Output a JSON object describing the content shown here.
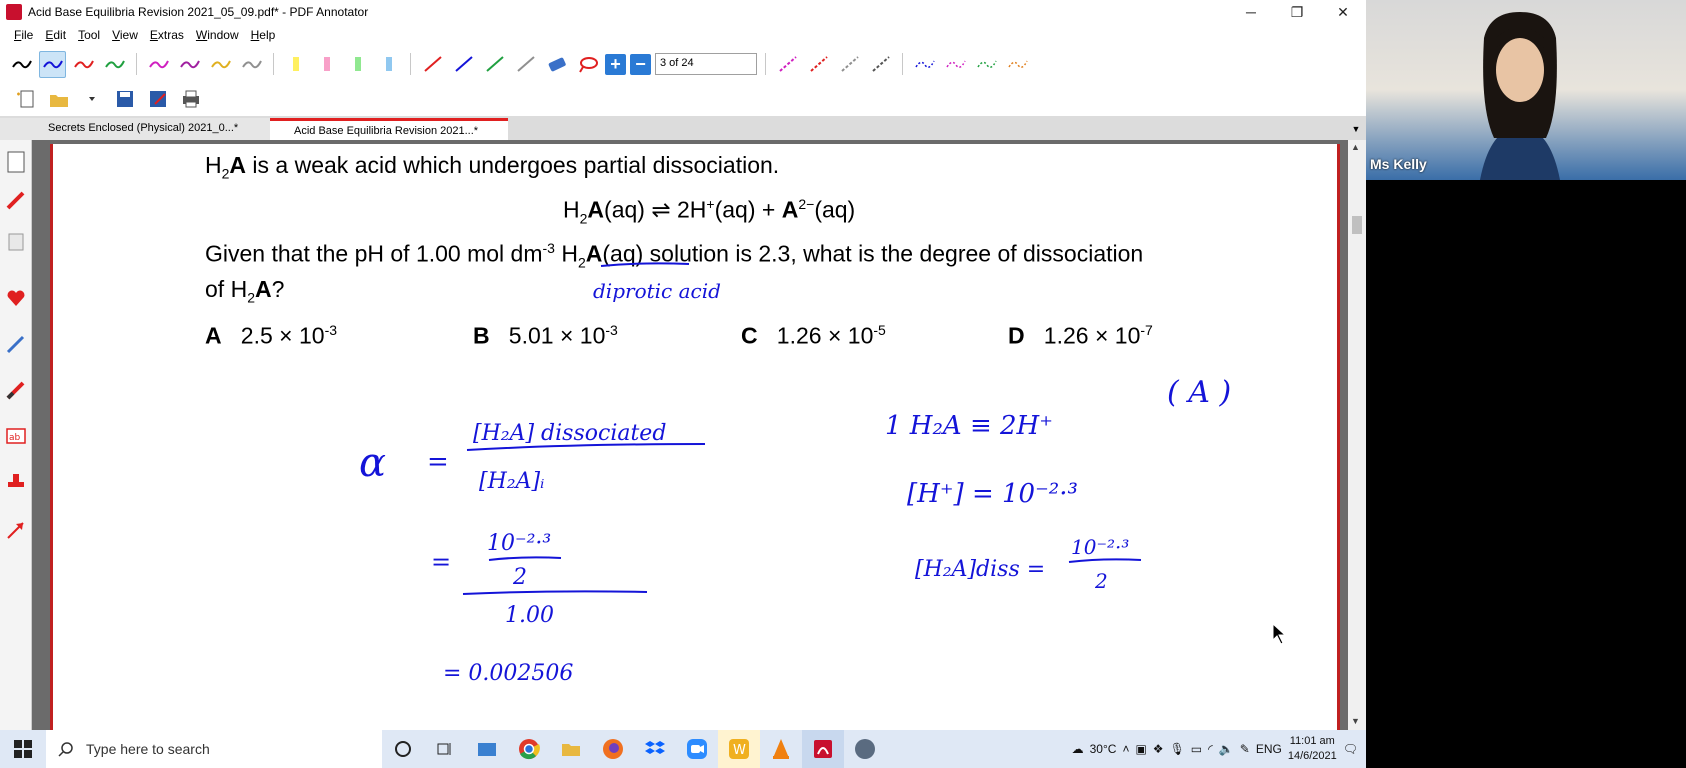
{
  "window": {
    "title": "Acid Base Equilibria Revision 2021_05_09.pdf* - PDF Annotator",
    "minimize": "─",
    "maximize": "❐",
    "close": "✕"
  },
  "menu": [
    "File",
    "Edit",
    "Tool",
    "View",
    "Extras",
    "Window",
    "Help"
  ],
  "toolbar": {
    "page_indicator": "3 of 24",
    "zoom_in": "+",
    "zoom_out": "−"
  },
  "tabs": [
    {
      "label": "Secrets Enclosed (Physical) 2021_0...*",
      "active": false
    },
    {
      "label": "Acid Base Equilibria Revision 2021...*",
      "active": true
    }
  ],
  "document": {
    "line1_pre": "H",
    "line1_sub": "2",
    "line1_bold": "A",
    "line1_post": " is a weak acid which undergoes partial dissociation.",
    "equation": {
      "h": "H",
      "sub": "2",
      "a": "A",
      "aq1": "(aq) ⇌ 2H",
      "sup1": "+",
      "aq2": "(aq) + ",
      "a2": "A",
      "sup2": "2−",
      "aq3": "(aq)"
    },
    "question_part1": "Given that the pH of 1.00 mol dm",
    "question_sup": "-3",
    "question_h": " H",
    "question_sub": "2",
    "question_a": "A",
    "question_part2": "(aq) solution is 2.3, what is the degree of dissociation",
    "question_line2_pre": "of H",
    "question_line2_sub": "2",
    "question_line2_a": "A",
    "question_line2_post": "?",
    "options": [
      {
        "letter": "A",
        "value": "2.5 × 10",
        "exp": "-3"
      },
      {
        "letter": "B",
        "value": "5.01 × 10",
        "exp": "-3"
      },
      {
        "letter": "C",
        "value": "1.26 × 10",
        "exp": "-5"
      },
      {
        "letter": "D",
        "value": "1.26 × 10",
        "exp": "-7"
      }
    ],
    "handwriting": {
      "diprotic": "diprotic acid",
      "answer": "( A )",
      "alpha_num": "[H₂A] dissociated",
      "alpha_den": "[H₂A]ᵢ",
      "frac_num": "10⁻²·³",
      "frac_num_den": "2",
      "frac_den": "1.00",
      "result": "= 0.002506",
      "ratio": "1 H₂A ≡ 2H⁺",
      "h_conc": "[H⁺] = 10⁻²·³",
      "diss": "[H₂A]diss =",
      "diss_num": "10⁻²·³",
      "diss_den": "2"
    }
  },
  "webcam": {
    "name": "Ms Kelly"
  },
  "taskbar": {
    "search_placeholder": "Type here to search",
    "weather": "30°C",
    "language": "ENG",
    "time": "11:01 am",
    "date": "14/6/2021"
  },
  "colors": {
    "ink": "#1414d8",
    "accent": "#e02020",
    "taskbar": "#dfe8f5"
  }
}
